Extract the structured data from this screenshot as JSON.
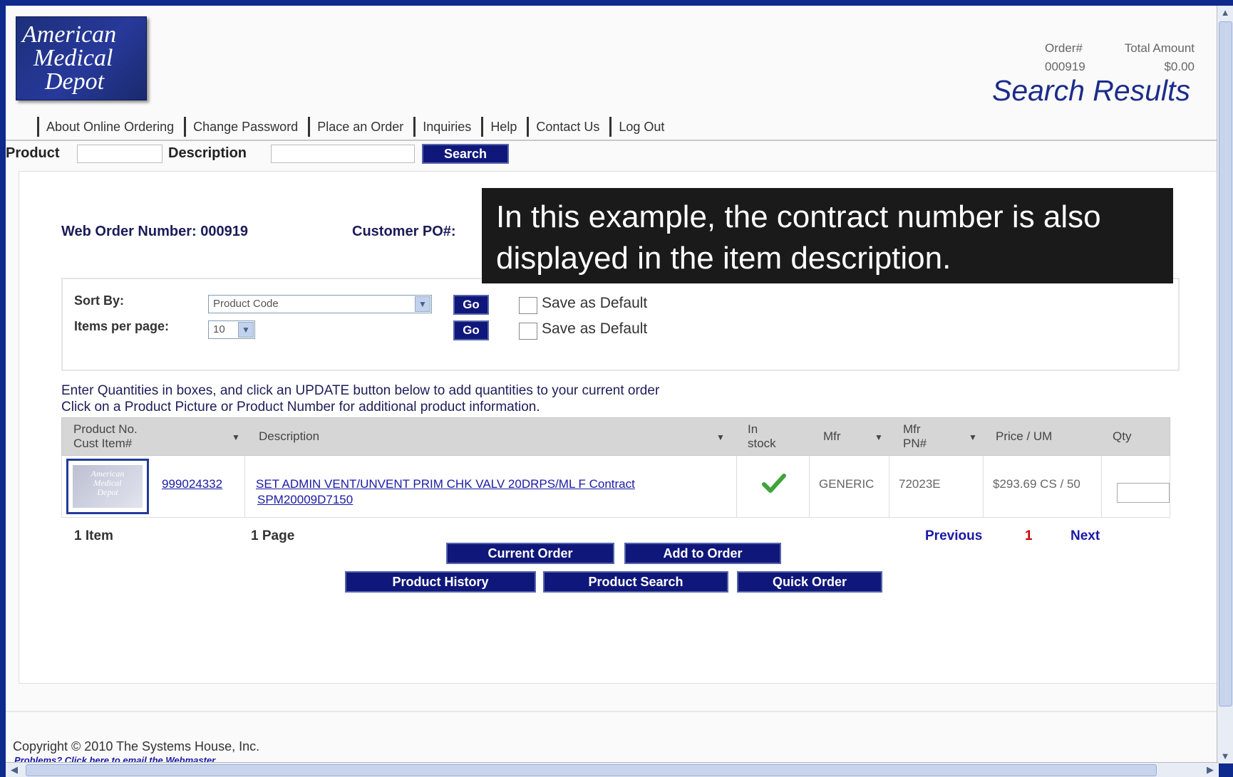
{
  "logo": {
    "line1": "American",
    "line2": "Medical",
    "line3": "Depot"
  },
  "order_info": {
    "order_label": "Order#",
    "total_label": "Total Amount",
    "order_number": "000919",
    "total_amount": "$0.00"
  },
  "page_title": "Search Results",
  "nav": [
    "About Online Ordering",
    "Change Password",
    "Place an Order",
    "Inquiries",
    "Help",
    "Contact Us",
    "Log Out"
  ],
  "search": {
    "product_label": "Product",
    "description_label": "Description",
    "button": "Search"
  },
  "order": {
    "web_order_label": "Web Order Number: 000919",
    "customer_po_label": "Customer PO#:"
  },
  "sort": {
    "sort_by_label": "Sort By:",
    "sort_value": "Product Code",
    "items_label": "Items per page:",
    "items_value": "10",
    "go": "Go",
    "save_default": "Save as Default"
  },
  "instructions": {
    "line1": "Enter Quantities in boxes, and click an UPDATE button below to add quantities to your current order",
    "line2": "Click on a Product Picture or Product Number for additional product information."
  },
  "table": {
    "headers": {
      "product_no": "Product No.",
      "cust_item": "Cust Item#",
      "description": "Description",
      "in_stock_1": "In",
      "in_stock_2": "stock",
      "mfr": "Mfr",
      "mfr_pn_1": "Mfr",
      "mfr_pn_2": "PN#",
      "price": "Price / UM",
      "qty": "Qty"
    },
    "rows": [
      {
        "product_no": "999024332",
        "desc_line1": "SET ADMIN VENT/UNVENT PRIM CHK VALV 20DRPS/ML F Contract",
        "desc_line2": "SPM20009D7150",
        "mfr": "GENERIC",
        "mfr_pn": "72023E",
        "price": "$293.69 CS / 50"
      }
    ]
  },
  "pager": {
    "items": "1 Item",
    "pages": "1 Page",
    "previous": "Previous",
    "current": "1",
    "next": "Next"
  },
  "buttons": {
    "current_order": "Current Order",
    "add_to_order": "Add to Order",
    "product_history": "Product History",
    "product_search": "Product Search",
    "quick_order": "Quick Order"
  },
  "footer": {
    "copyright": "Copyright © 2010 The Systems House, Inc.",
    "webmaster": "Problems? Click here to email the Webmaster"
  },
  "callout": "In this example, the contract number is also displayed in the item description.",
  "colors": {
    "accent": "#10177a",
    "title": "#1b2d8a",
    "frame": "#0e2a8c"
  }
}
